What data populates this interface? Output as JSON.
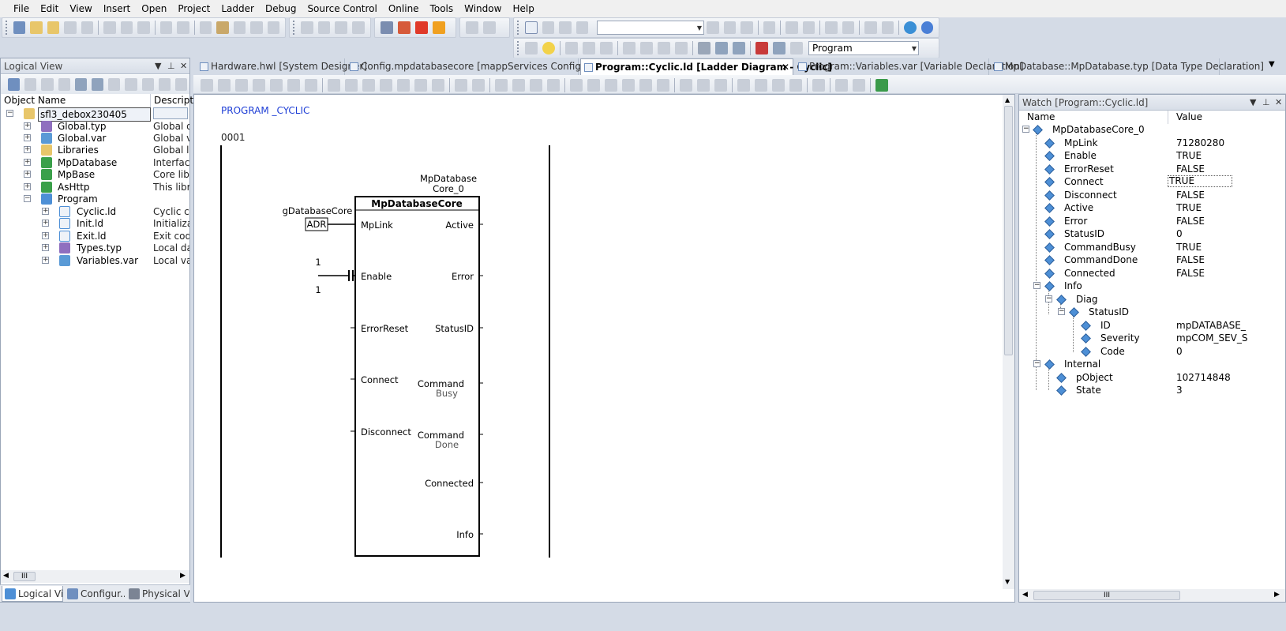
{
  "menu": [
    "File",
    "Edit",
    "View",
    "Insert",
    "Open",
    "Project",
    "Ladder",
    "Debug",
    "Source Control",
    "Online",
    "Tools",
    "Window",
    "Help"
  ],
  "toolbar": {
    "program_combo_value": "Program"
  },
  "logical_view": {
    "title": "Logical View",
    "col_name": "Object Name",
    "col_desc": "Descriptio",
    "items": [
      {
        "name": "sfl3_debox230405",
        "desc": ""
      },
      {
        "name": "Global.typ",
        "desc": "Global da"
      },
      {
        "name": "Global.var",
        "desc": "Global va"
      },
      {
        "name": "Libraries",
        "desc": "Global libr"
      },
      {
        "name": "MpDatabase",
        "desc": "Interface"
      },
      {
        "name": "MpBase",
        "desc": "Core librar"
      },
      {
        "name": "AsHttp",
        "desc": "This librar"
      },
      {
        "name": "Program",
        "desc": ""
      },
      {
        "name": "Cyclic.ld",
        "desc": "Cyclic coo"
      },
      {
        "name": "Init.ld",
        "desc": "Initializatio"
      },
      {
        "name": "Exit.ld",
        "desc": "Exit code"
      },
      {
        "name": "Types.typ",
        "desc": "Local data"
      },
      {
        "name": "Variables.var",
        "desc": "Local vari"
      }
    ],
    "hscroll_label": "III",
    "bottom_tabs": [
      "Logical Vi...",
      "Configur...",
      "Physical V..."
    ]
  },
  "doc_tabs": [
    "Hardware.hwl [System Designer]",
    "Config.mpdatabasecore [mappServices Configuration]",
    "Program::Cyclic.ld [Ladder Diagram - Cyclic]",
    "Program::Variables.var [Variable Declaration]",
    "MpDatabase::MpDatabase.typ [Data Type Declaration]"
  ],
  "editor": {
    "program_header": "PROGRAM _CYCLIC",
    "rung_number": "0001",
    "instance_name_1": "MpDatabase",
    "instance_name_2": "Core_0",
    "fb_type": "MpDatabaseCore",
    "inputs": [
      "MpLink",
      "Enable",
      "ErrorReset",
      "Connect",
      "Disconnect"
    ],
    "outputs": [
      "Active",
      "Error",
      "StatusID",
      "Command",
      "Command",
      "Connected",
      "Info"
    ],
    "outputs_overflow": [
      "Busy",
      "Done"
    ],
    "var_db": "gDatabaseCore",
    "adr": "ADR",
    "contact_val_top": "1",
    "contact_val_bottom": "1"
  },
  "watch": {
    "title": "Watch [Program::Cyclic.ld]",
    "col_name": "Name",
    "col_value": "Value",
    "rows": [
      {
        "name": "MpDatabaseCore_0",
        "value": ""
      },
      {
        "name": "MpLink",
        "value": "71280280"
      },
      {
        "name": "Enable",
        "value": "TRUE"
      },
      {
        "name": "ErrorReset",
        "value": "FALSE"
      },
      {
        "name": "Connect",
        "value": "TRUE"
      },
      {
        "name": "Disconnect",
        "value": "FALSE"
      },
      {
        "name": "Active",
        "value": "TRUE"
      },
      {
        "name": "Error",
        "value": "FALSE"
      },
      {
        "name": "StatusID",
        "value": "0"
      },
      {
        "name": "CommandBusy",
        "value": "TRUE"
      },
      {
        "name": "CommandDone",
        "value": "FALSE"
      },
      {
        "name": "Connected",
        "value": "FALSE"
      },
      {
        "name": "Info",
        "value": ""
      },
      {
        "name": "Diag",
        "value": ""
      },
      {
        "name": "StatusID",
        "value": ""
      },
      {
        "name": "ID",
        "value": "mpDATABASE_"
      },
      {
        "name": "Severity",
        "value": "mpCOM_SEV_S"
      },
      {
        "name": "Code",
        "value": "0"
      },
      {
        "name": "Internal",
        "value": ""
      },
      {
        "name": "pObject",
        "value": "102714848"
      },
      {
        "name": "State",
        "value": "3"
      }
    ],
    "hscroll_label": "III"
  }
}
